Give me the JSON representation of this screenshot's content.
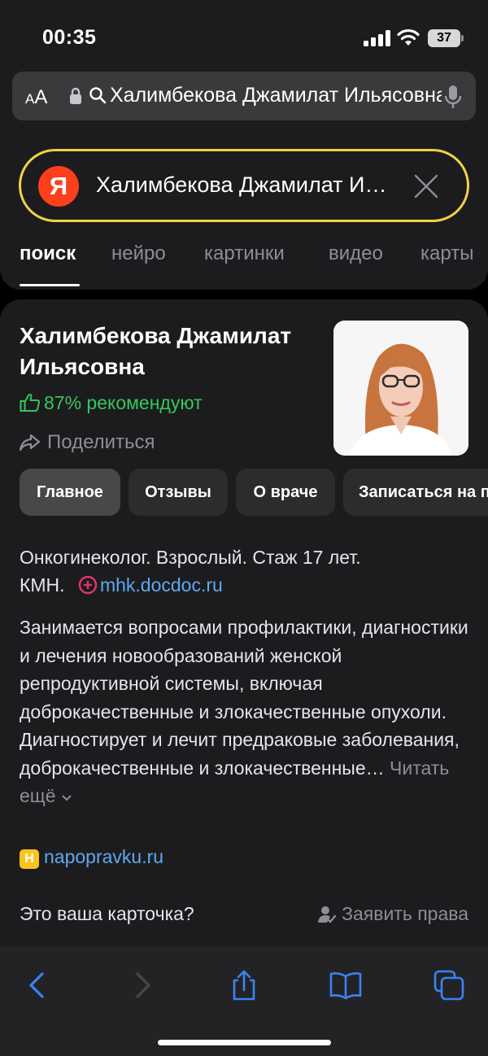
{
  "status_bar": {
    "time": "00:35",
    "battery": "37"
  },
  "browser": {
    "text_size_label_small": "A",
    "text_size_label_large": "A",
    "url_text": "Халимбекова Джамилат Ильясовна"
  },
  "search": {
    "logo_letter": "Я",
    "query": "Халимбекова Джамилат Ильясовна",
    "tabs": [
      {
        "label": "поиск",
        "active": true
      },
      {
        "label": "нейро"
      },
      {
        "label": "картинки"
      },
      {
        "label": "видео"
      },
      {
        "label": "карты"
      }
    ]
  },
  "card": {
    "name": "Халимбекова Джамилат Ильясовна",
    "recommend": "87% рекомендуют",
    "share": "Поделиться",
    "chips": [
      {
        "label": "Главное",
        "active": true
      },
      {
        "label": "Отзывы"
      },
      {
        "label": "О враче"
      },
      {
        "label": "Записаться на прием"
      }
    ],
    "summary": "Онкогинеколог. Взрослый. Стаж 17 лет.",
    "degree": "КМН.",
    "source1": "mhk.docdoc.ru",
    "description": "Занимается вопросами профилактики, диагностики и лечения новообразований женской репродуктивной системы, включая доброкачественные и злокачественные опухоли. Диагностирует и лечит предраковые заболевания, доброкачественные и злокачественные…",
    "read_more": "Читать ещё",
    "source2_icon": "Н",
    "source2": "napopravku.ru",
    "claim_question": "Это ваша карточка?",
    "claim_button": "Заявить права"
  },
  "icons": {
    "lock": "lock-icon",
    "search": "search-icon",
    "mic": "microphone-icon",
    "clear": "close-icon",
    "like": "thumbs-up-icon",
    "share": "share-arrow-icon",
    "back": "back-icon",
    "forward": "forward-icon",
    "share_sheet": "share-icon",
    "bookmarks": "bookmarks-icon",
    "tabs": "tabs-icon"
  },
  "colors": {
    "accent": "#f2d049",
    "brand": "#fc3f1d",
    "link": "#5fa8f0",
    "positive": "#35c75a"
  }
}
